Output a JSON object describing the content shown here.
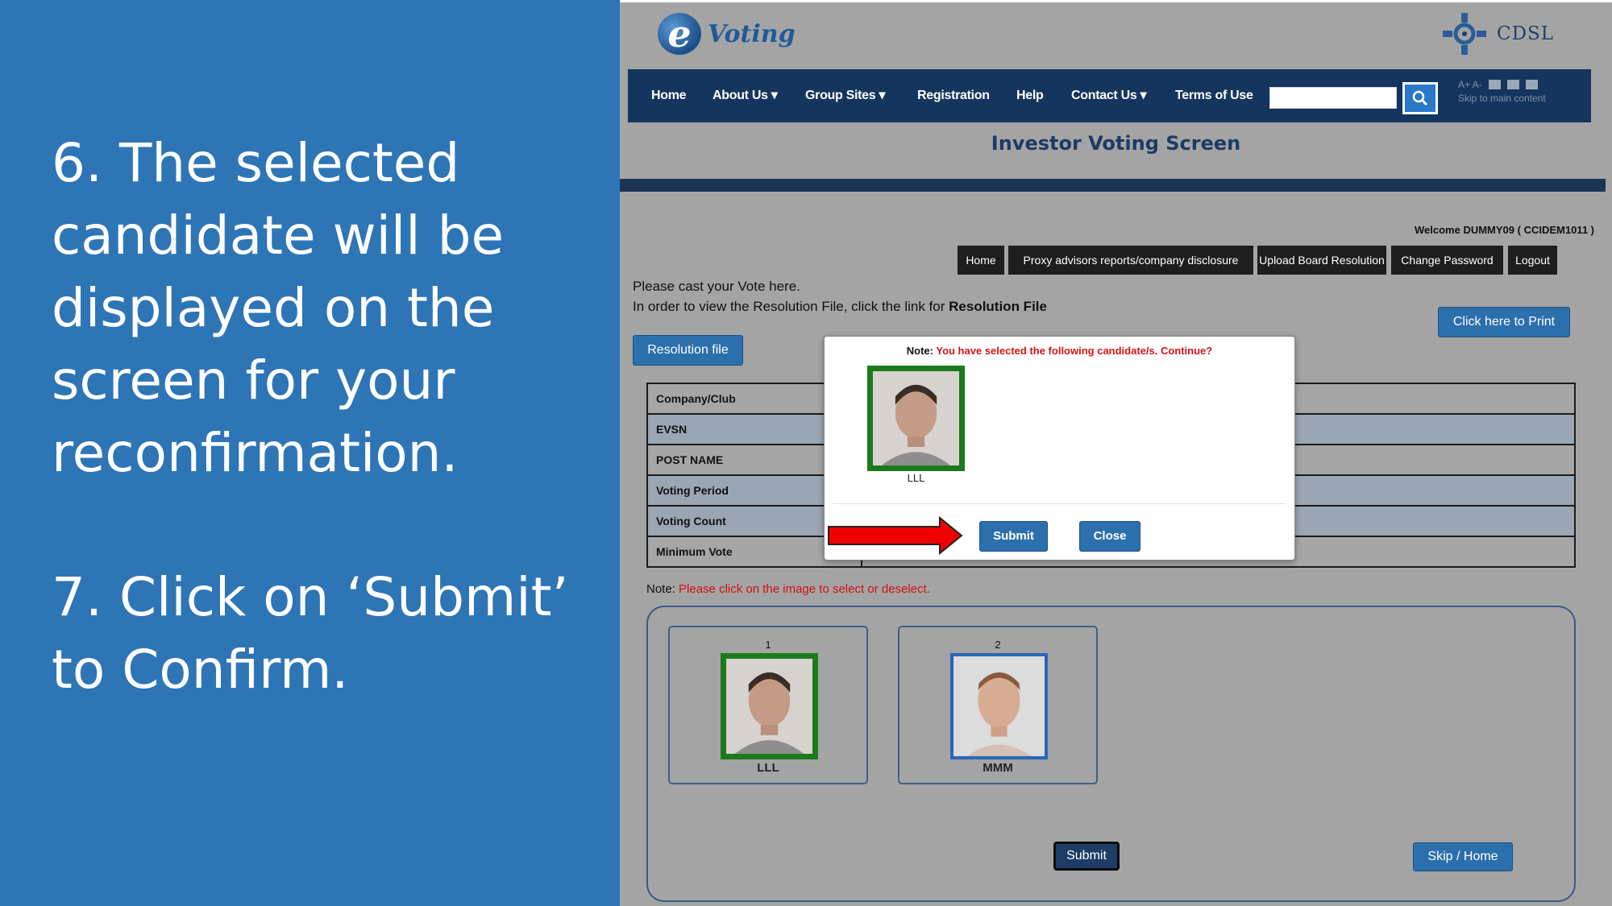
{
  "instructions": {
    "step6": "6. The selected candidate will be displayed on the screen for your reconfirmation.",
    "step7": "7. Click on ‘Submit’ to Confirm."
  },
  "header": {
    "logo_e": "e",
    "logo_text": "Voting",
    "cdsl_text": "CDSL"
  },
  "nav": {
    "items": [
      "Home",
      "About Us ▾",
      "Group Sites ▾",
      "Registration",
      "Help",
      "Contact Us ▾",
      "Terms of Use"
    ],
    "search_placeholder": "",
    "tools_text": "A+  A-",
    "skip_text": "Skip to main content"
  },
  "page": {
    "title": "Investor Voting Screen",
    "welcome": "Welcome DUMMY09 ( CCIDEM1011 )",
    "tabs": [
      "Home",
      "Proxy advisors reports/company disclosure",
      "Upload Board Resolution",
      "Change Password",
      "Logout"
    ],
    "cast_line1": "Please cast your Vote here.",
    "cast_line2_prefix": "In order to view the Resolution File, click the link for ",
    "cast_line2_bold": "Resolution File",
    "print_button": "Click here to Print",
    "resolution_button": "Resolution file"
  },
  "info_table": {
    "rows": [
      "Company/Club",
      "EVSN",
      "POST NAME",
      "Voting Period",
      "Voting Count",
      "Minimum Vote"
    ]
  },
  "candidates": {
    "note_prefix": "Note: ",
    "note_red": "Please click on the image to select or deselect.",
    "items": [
      {
        "number": "1",
        "name": "LLL",
        "selected": true
      },
      {
        "number": "2",
        "name": "MMM",
        "selected": false
      }
    ],
    "submit": "Submit",
    "skip": "Skip / Home"
  },
  "modal": {
    "note_prefix": "Note: ",
    "note_red": "You have selected the following candidate/s. Continue?",
    "candidate_name": "LLL",
    "submit": "Submit",
    "close": "Close"
  },
  "colors": {
    "panel_blue": "#2e75b6",
    "nav_navy": "#14365e",
    "selected_green": "#1c7a1c",
    "alert_red": "#d51515"
  }
}
